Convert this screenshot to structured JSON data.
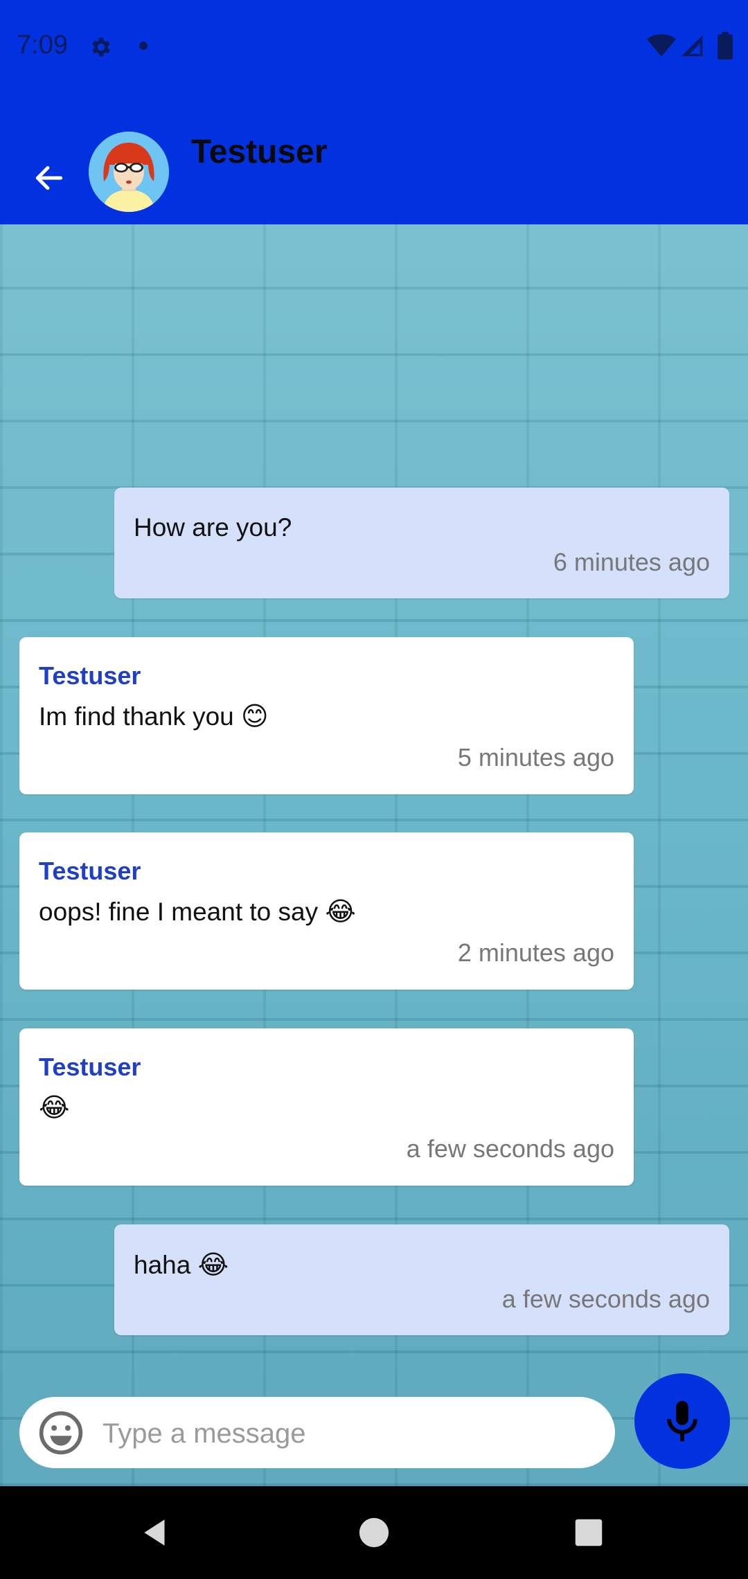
{
  "status_bar": {
    "time": "7:09",
    "icons": [
      "gear-icon",
      "notification-dot-icon",
      "wifi-icon",
      "signal-icon",
      "battery-icon"
    ]
  },
  "header": {
    "contact_name": "Testuser",
    "back_icon": "arrow-left-icon",
    "avatar": "user-avatar"
  },
  "colors": {
    "primary": "#0231e0",
    "outgoing_bubble": "#d5e0fa",
    "incoming_bubble": "#ffffff",
    "sender_name": "#1f3fc6",
    "timestamp": "#777777"
  },
  "messages": [
    {
      "direction": "outgoing",
      "sender": "",
      "text": "How are you?",
      "emoji": "",
      "time": "6 minutes ago"
    },
    {
      "direction": "incoming",
      "sender": "Testuser",
      "text": "Im find thank you ",
      "emoji": "😊",
      "time": "5 minutes ago"
    },
    {
      "direction": "incoming",
      "sender": "Testuser",
      "text": "oops! fine I meant to say ",
      "emoji": "😂",
      "time": "2 minutes ago"
    },
    {
      "direction": "incoming",
      "sender": "Testuser",
      "text": "",
      "emoji": "😂",
      "time": "a few seconds ago"
    },
    {
      "direction": "outgoing",
      "sender": "",
      "text": "haha ",
      "emoji": "😂",
      "time": "a few seconds ago"
    }
  ],
  "composer": {
    "placeholder": "Type a message",
    "value": "",
    "emoji_icon": "smiley-icon",
    "mic_icon": "microphone-icon"
  },
  "nav_bar": {
    "icons": [
      "nav-back-icon",
      "nav-home-icon",
      "nav-recents-icon"
    ]
  }
}
